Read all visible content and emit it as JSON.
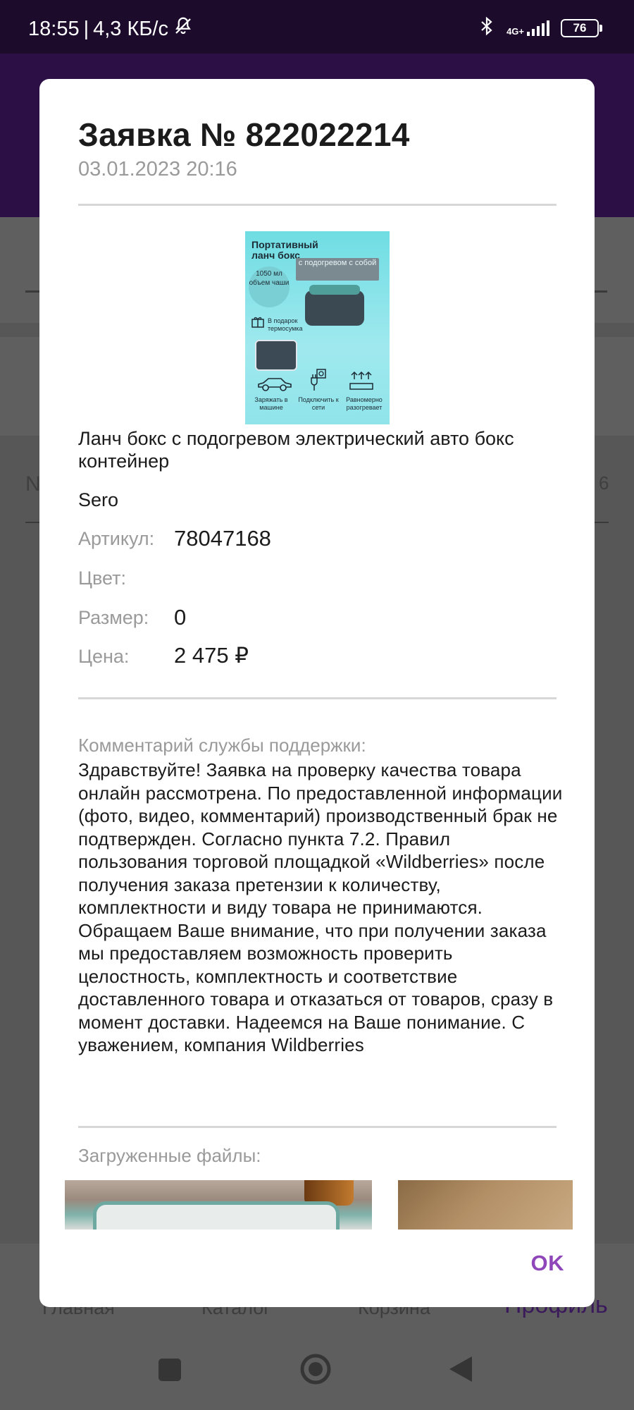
{
  "status_bar": {
    "time": "18:55",
    "separator": "|",
    "speed": "4,3 КБ/с",
    "network": "4G+",
    "battery": "76"
  },
  "background": {
    "row_prefix": "N",
    "row_suffix": "6",
    "nav": {
      "home": "Главная",
      "catalog": "Каталог",
      "cart": "Корзина",
      "profile": "Профиль"
    }
  },
  "dialog": {
    "title": "Заявка № 822022214",
    "date": "03.01.2023 20:16",
    "product": {
      "image_texts": {
        "heading": "Портативный ланч бокс",
        "tag": "с подогревом с собой",
        "volume": "1050 мл объем чаши",
        "gift": "В подарок термосумка",
        "feature1": "Заряжать в машине",
        "feature2": "Подключить к сети",
        "feature3": "Равномерно разогревает"
      },
      "name": "Ланч бокс с подогревом электрический авто бокс контейнер",
      "brand": "Sero",
      "article_label": "Артикул:",
      "article_value": "78047168",
      "color_label": "Цвет:",
      "color_value": "",
      "size_label": "Размер:",
      "size_value": "0",
      "price_label": "Цена:",
      "price_value": "2 475 ₽"
    },
    "comment_label": "Комментарий службы поддержки:",
    "comment_text": "Здравствуйте! Заявка на проверку качества товара онлайн рассмотрена. По предоставленной информации (фото, видео, комментарий) производственный брак не подтвержден. Согласно пункта 7.2. Правил пользования торговой площадкой «Wildberries» после получения заказа претензии к количеству, комплектности и виду товара не принимаются. Обращаем Ваше внимание, что при получении заказа мы предоставляем возможность проверить целостность, комплектность и соответствие доставленного товара и отказаться от товаров, сразу в момент доставки. Надеемся на Ваше понимание. С уважением, компания Wildberries",
    "files_label": "Загруженные файлы:",
    "ok_label": "OK"
  }
}
